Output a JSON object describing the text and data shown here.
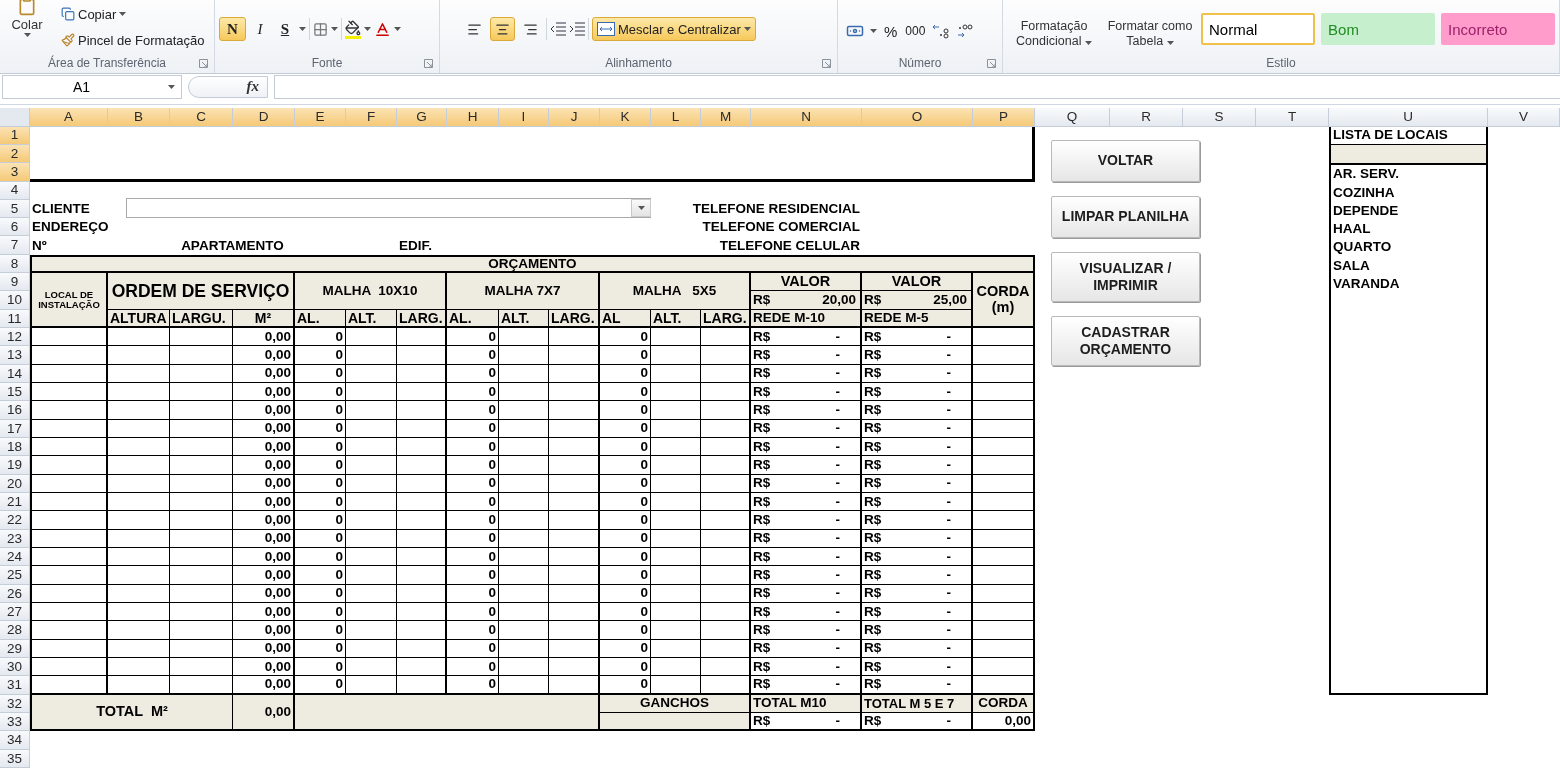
{
  "ribbon": {
    "groups": [
      {
        "kind": "clipboard",
        "label": "Área de Transferência",
        "paste": "Colar",
        "copy": "Copiar",
        "format_painter": "Pincel de Formatação"
      },
      {
        "kind": "font",
        "label": "Fonte",
        "buttons": [
          {
            "text": "N",
            "selected": true
          },
          {
            "text": "I",
            "selected": false
          },
          {
            "text": "S",
            "selected": false
          }
        ]
      },
      {
        "kind": "alignment",
        "label": "Alinhamento",
        "align": [
          {
            "selected": false
          },
          {
            "selected": true
          },
          {
            "selected": false
          }
        ],
        "merge": {
          "label": "Mesclar e Centralizar",
          "selected": true
        }
      },
      {
        "kind": "number",
        "label": "Número",
        "percent": "%",
        "thousands": "000"
      },
      {
        "kind": "styles",
        "label": "Estilo",
        "conditional": "Formatação Condicional",
        "table": "Formatar como Tabela",
        "styles": [
          {
            "label": "Normal",
            "selected": true,
            "color": "#ffffff"
          },
          {
            "label": "Bom",
            "selected": false,
            "color": "#c6efce"
          },
          {
            "label": "Incorreto",
            "selected": false,
            "color": "#ff9ccc"
          }
        ]
      }
    ]
  },
  "formula_bar": {
    "name_box": "A1",
    "fx": "fx"
  },
  "sheet": {
    "columns": [
      {
        "label": "A",
        "selected": true
      },
      {
        "label": "B",
        "selected": true
      },
      {
        "label": "C",
        "selected": true
      },
      {
        "label": "D",
        "selected": true
      },
      {
        "label": "E",
        "selected": true
      },
      {
        "label": "F",
        "selected": true
      },
      {
        "label": "G",
        "selected": true
      },
      {
        "label": "H",
        "selected": true
      },
      {
        "label": "I",
        "selected": true
      },
      {
        "label": "J",
        "selected": true
      },
      {
        "label": "K",
        "selected": true
      },
      {
        "label": "L",
        "selected": true
      },
      {
        "label": "M",
        "selected": true
      },
      {
        "label": "N",
        "selected": true
      },
      {
        "label": "O",
        "selected": true
      },
      {
        "label": "P",
        "selected": true
      },
      {
        "label": "Q",
        "selected": false
      },
      {
        "label": "R",
        "selected": false
      },
      {
        "label": "S",
        "selected": false
      },
      {
        "label": "T",
        "selected": false
      },
      {
        "label": "U",
        "selected": false
      },
      {
        "label": "V",
        "selected": false
      }
    ],
    "rows": [
      {
        "label": "1",
        "selected": true
      },
      {
        "label": "2",
        "selected": true
      },
      {
        "label": "3",
        "selected": true
      },
      {
        "label": "4",
        "selected": false
      },
      {
        "label": "5",
        "selected": false
      },
      {
        "label": "6",
        "selected": false
      },
      {
        "label": "7",
        "selected": false
      },
      {
        "label": "8",
        "selected": false
      },
      {
        "label": "9",
        "selected": false
      },
      {
        "label": "10",
        "selected": false
      },
      {
        "label": "11",
        "selected": false
      },
      {
        "label": "12",
        "selected": false
      },
      {
        "label": "13",
        "selected": false
      },
      {
        "label": "14",
        "selected": false
      },
      {
        "label": "15",
        "selected": false
      },
      {
        "label": "16",
        "selected": false
      },
      {
        "label": "17",
        "selected": false
      },
      {
        "label": "18",
        "selected": false
      },
      {
        "label": "19",
        "selected": false
      },
      {
        "label": "20",
        "selected": false
      },
      {
        "label": "21",
        "selected": false
      },
      {
        "label": "22",
        "selected": false
      },
      {
        "label": "23",
        "selected": false
      },
      {
        "label": "24",
        "selected": false
      },
      {
        "label": "25",
        "selected": false
      },
      {
        "label": "26",
        "selected": false
      },
      {
        "label": "27",
        "selected": false
      },
      {
        "label": "28",
        "selected": false
      },
      {
        "label": "29",
        "selected": false
      },
      {
        "label": "30",
        "selected": false
      },
      {
        "label": "31",
        "selected": false
      },
      {
        "label": "32",
        "selected": false
      },
      {
        "label": "33",
        "selected": false
      },
      {
        "label": "34",
        "selected": false
      },
      {
        "label": "35",
        "selected": false
      }
    ]
  },
  "form": {
    "cliente": "CLIENTE",
    "endereco": "ENDEREÇO",
    "numero": "Nº",
    "apartamento": "APARTAMENTO",
    "edificio": "EDIF.",
    "tel_res": "TELEFONE RESIDENCIAL",
    "tel_com": "TELEFONE COMERCIAL",
    "tel_cel": "TELEFONE CELULAR"
  },
  "table": {
    "title": "ORÇAMENTO",
    "local": "LOCAL DE INSTALAÇÃO",
    "ordem": {
      "title": "ORDEM DE SERVIÇO",
      "cols": [
        "ALTURA",
        "LARGU.",
        "M²"
      ]
    },
    "malhas": [
      {
        "title": "MALHA  10X10",
        "cols": [
          "AL.",
          "ALT.",
          "LARG."
        ]
      },
      {
        "title": "MALHA 7X7",
        "cols": [
          "AL.",
          "ALT.",
          "LARG."
        ]
      },
      {
        "title": "MALHA   5X5",
        "cols": [
          "AL",
          "ALT.",
          "LARG."
        ]
      }
    ],
    "valores": [
      {
        "title": "VALOR",
        "currency": "R$",
        "price": "20,00",
        "net": "REDE M-10"
      },
      {
        "title": "VALOR",
        "currency": "R$",
        "price": "25,00",
        "net": "REDE M-5"
      }
    ],
    "corda": "CORDA (m)",
    "rows": [
      {
        "m2": "0,00",
        "al": [
          "0",
          "0",
          "0"
        ],
        "rede_m10": [
          "R$",
          "-"
        ],
        "rede_m5": [
          "R$",
          "-"
        ]
      },
      {
        "m2": "0,00",
        "al": [
          "0",
          "0",
          "0"
        ],
        "rede_m10": [
          "R$",
          "-"
        ],
        "rede_m5": [
          "R$",
          "-"
        ]
      },
      {
        "m2": "0,00",
        "al": [
          "0",
          "0",
          "0"
        ],
        "rede_m10": [
          "R$",
          "-"
        ],
        "rede_m5": [
          "R$",
          "-"
        ]
      },
      {
        "m2": "0,00",
        "al": [
          "0",
          "0",
          "0"
        ],
        "rede_m10": [
          "R$",
          "-"
        ],
        "rede_m5": [
          "R$",
          "-"
        ]
      },
      {
        "m2": "0,00",
        "al": [
          "0",
          "0",
          "0"
        ],
        "rede_m10": [
          "R$",
          "-"
        ],
        "rede_m5": [
          "R$",
          "-"
        ]
      },
      {
        "m2": "0,00",
        "al": [
          "0",
          "0",
          "0"
        ],
        "rede_m10": [
          "R$",
          "-"
        ],
        "rede_m5": [
          "R$",
          "-"
        ]
      },
      {
        "m2": "0,00",
        "al": [
          "0",
          "0",
          "0"
        ],
        "rede_m10": [
          "R$",
          "-"
        ],
        "rede_m5": [
          "R$",
          "-"
        ]
      },
      {
        "m2": "0,00",
        "al": [
          "0",
          "0",
          "0"
        ],
        "rede_m10": [
          "R$",
          "-"
        ],
        "rede_m5": [
          "R$",
          "-"
        ]
      },
      {
        "m2": "0,00",
        "al": [
          "0",
          "0",
          "0"
        ],
        "rede_m10": [
          "R$",
          "-"
        ],
        "rede_m5": [
          "R$",
          "-"
        ]
      },
      {
        "m2": "0,00",
        "al": [
          "0",
          "0",
          "0"
        ],
        "rede_m10": [
          "R$",
          "-"
        ],
        "rede_m5": [
          "R$",
          "-"
        ]
      },
      {
        "m2": "0,00",
        "al": [
          "0",
          "0",
          "0"
        ],
        "rede_m10": [
          "R$",
          "-"
        ],
        "rede_m5": [
          "R$",
          "-"
        ]
      },
      {
        "m2": "0,00",
        "al": [
          "0",
          "0",
          "0"
        ],
        "rede_m10": [
          "R$",
          "-"
        ],
        "rede_m5": [
          "R$",
          "-"
        ]
      },
      {
        "m2": "0,00",
        "al": [
          "0",
          "0",
          "0"
        ],
        "rede_m10": [
          "R$",
          "-"
        ],
        "rede_m5": [
          "R$",
          "-"
        ]
      },
      {
        "m2": "0,00",
        "al": [
          "0",
          "0",
          "0"
        ],
        "rede_m10": [
          "R$",
          "-"
        ],
        "rede_m5": [
          "R$",
          "-"
        ]
      },
      {
        "m2": "0,00",
        "al": [
          "0",
          "0",
          "0"
        ],
        "rede_m10": [
          "R$",
          "-"
        ],
        "rede_m5": [
          "R$",
          "-"
        ]
      },
      {
        "m2": "0,00",
        "al": [
          "0",
          "0",
          "0"
        ],
        "rede_m10": [
          "R$",
          "-"
        ],
        "rede_m5": [
          "R$",
          "-"
        ]
      },
      {
        "m2": "0,00",
        "al": [
          "0",
          "0",
          "0"
        ],
        "rede_m10": [
          "R$",
          "-"
        ],
        "rede_m5": [
          "R$",
          "-"
        ]
      },
      {
        "m2": "0,00",
        "al": [
          "0",
          "0",
          "0"
        ],
        "rede_m10": [
          "R$",
          "-"
        ],
        "rede_m5": [
          "R$",
          "-"
        ]
      },
      {
        "m2": "0,00",
        "al": [
          "0",
          "0",
          "0"
        ],
        "rede_m10": [
          "R$",
          "-"
        ],
        "rede_m5": [
          "R$",
          "-"
        ]
      },
      {
        "m2": "0,00",
        "al": [
          "0",
          "0",
          "0"
        ],
        "rede_m10": [
          "R$",
          "-"
        ],
        "rede_m5": [
          "R$",
          "-"
        ]
      }
    ],
    "totals": {
      "label": "TOTAL  M²",
      "m2": "0,00",
      "ganchos": "GANCHOS",
      "total_m10": "TOTAL M10",
      "total_m10_value": [
        "R$",
        "-"
      ],
      "total_m5": "TOTAL M 5 E 7",
      "total_m5_value": [
        "R$",
        "-"
      ],
      "corda": "CORDA",
      "corda_value": "0,00"
    }
  },
  "buttons": [
    "VOLTAR",
    "LIMPAR PLANILHA",
    "VISUALIZAR / IMPRIMIR",
    "CADASTRAR ORÇAMENTO"
  ],
  "locais": {
    "title": "LISTA DE LOCAIS",
    "items": [
      "AR. SERV.",
      "COZINHA",
      "DEPENDE",
      "HAAL",
      "QUARTO",
      "SALA",
      "VARANDA"
    ]
  }
}
